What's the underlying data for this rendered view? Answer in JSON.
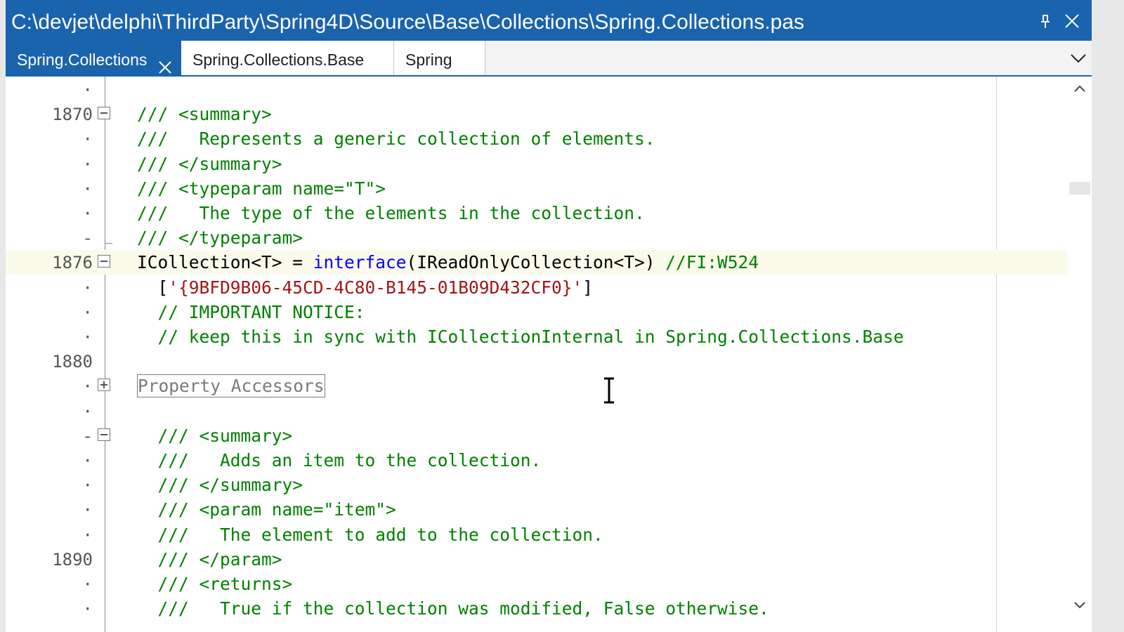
{
  "window": {
    "title": "C:\\devjet\\delphi\\ThirdParty\\Spring4D\\Source\\Base\\Collections\\Spring.Collections.pas"
  },
  "tabs": [
    {
      "label": "Spring.Collections",
      "active": true
    },
    {
      "label": "Spring.Collections.Base",
      "active": false
    },
    {
      "label": "Spring",
      "active": false
    }
  ],
  "icons": {
    "pin": "pin-icon",
    "close": "close-icon",
    "tab_close": "close-icon",
    "tabs_dropdown": "chevron-down-icon",
    "scroll_up": "chevron-up-icon",
    "scroll_down": "chevron-down-icon"
  },
  "colors": {
    "accent": "#1a63ad",
    "comment": "#008000",
    "keyword": "#0000ff",
    "string": "#a31515"
  },
  "editor": {
    "lines": [
      {
        "num": "·",
        "fold": "line",
        "code": ""
      },
      {
        "num": "1870",
        "fold": "minus",
        "code": "/// <summary>"
      },
      {
        "num": "·",
        "fold": "line",
        "code": "///   Represents a generic collection of elements."
      },
      {
        "num": "·",
        "fold": "line",
        "code": "/// </summary>"
      },
      {
        "num": "·",
        "fold": "line",
        "code": "/// <typeparam name=\"T\">"
      },
      {
        "num": "·",
        "fold": "line",
        "code": "///   The type of the elements in the collection."
      },
      {
        "num": "-",
        "fold": "end",
        "code": "/// </typeparam>"
      },
      {
        "num": "1876",
        "fold": "minus",
        "code_pre": "ICollection<T> = ",
        "code_kw": "interface",
        "code_post": "(IReadOnlyCollection<T>) ",
        "code_comment": "//FI:W524"
      },
      {
        "num": "·",
        "fold": "line",
        "code_pre": "  [",
        "code_str": "'{9BFD9B06-45CD-4C80-B145-01B09D432CF0}'",
        "code_post": "]"
      },
      {
        "num": "·",
        "fold": "line",
        "code": "  // IMPORTANT NOTICE:"
      },
      {
        "num": "·",
        "fold": "line",
        "code": "  // keep this in sync with ICollectionInternal in Spring.Collections.Base"
      },
      {
        "num": "1880",
        "fold": "line",
        "code": ""
      },
      {
        "num": "·",
        "fold": "plus",
        "region": "Property Accessors"
      },
      {
        "num": "·",
        "fold": "line",
        "code": ""
      },
      {
        "num": "-",
        "fold": "minus",
        "code": "  /// <summary>"
      },
      {
        "num": "·",
        "fold": "line",
        "code": "  ///   Adds an item to the collection."
      },
      {
        "num": "·",
        "fold": "line",
        "code": "  /// </summary>"
      },
      {
        "num": "·",
        "fold": "line",
        "code": "  /// <param name=\"item\">"
      },
      {
        "num": "·",
        "fold": "line",
        "code": "  ///   The element to add to the collection."
      },
      {
        "num": "1890",
        "fold": "line",
        "code": "  /// </param>"
      },
      {
        "num": "·",
        "fold": "line",
        "code": "  /// <returns>"
      },
      {
        "num": "·",
        "fold": "line",
        "code": "  ///   True if the collection was modified, False otherwise."
      }
    ]
  }
}
